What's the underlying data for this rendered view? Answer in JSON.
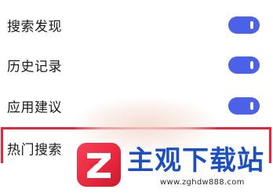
{
  "settings": {
    "items": [
      {
        "label": "搜索发现",
        "enabled": true
      },
      {
        "label": "历史记录",
        "enabled": true
      },
      {
        "label": "应用建议",
        "enabled": true
      },
      {
        "label": "热门搜索",
        "highlighted": true
      }
    ]
  },
  "colors": {
    "toggle_on": "#4a61e8",
    "highlight": "#e8263b",
    "watermark_text": "#1d4fc4"
  },
  "watermark": {
    "title": "主观下载站",
    "url": "www.zghdw888.com",
    "logo_icon": "z-logo-icon"
  }
}
